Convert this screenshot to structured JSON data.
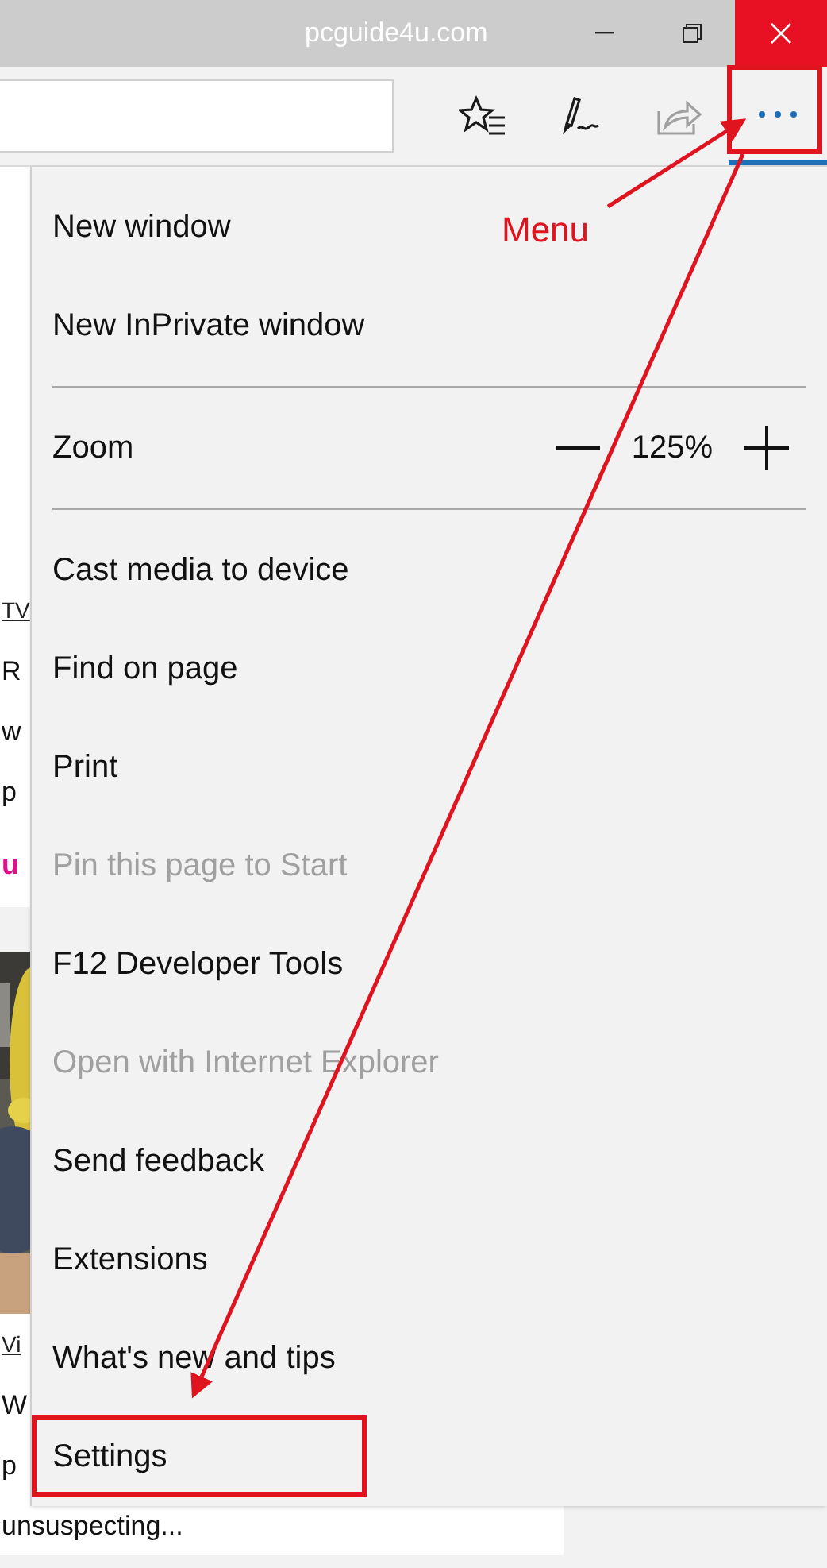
{
  "window": {
    "title": "pcguide4u.com"
  },
  "toolbar": {
    "buttons": [
      {
        "kind": "favorites",
        "disabled": false
      },
      {
        "kind": "notes",
        "disabled": false
      },
      {
        "kind": "share",
        "disabled": true
      },
      {
        "kind": "more",
        "disabled": false
      }
    ]
  },
  "page": {
    "fragments": [
      {
        "kind": "tag",
        "text": "TV"
      },
      {
        "kind": "headline",
        "text": "R"
      },
      {
        "kind": "headline",
        "text": "w"
      },
      {
        "kind": "headline",
        "text": "p"
      },
      {
        "kind": "brand",
        "text": "u"
      },
      {
        "kind": "picture"
      },
      {
        "kind": "tag",
        "text": "Vi"
      },
      {
        "kind": "headline",
        "text": "W"
      },
      {
        "kind": "headline",
        "text": "p"
      },
      {
        "kind": "headline",
        "text": "unsuspecting..."
      }
    ]
  },
  "menu": {
    "items": [
      {
        "kind": "item",
        "label": "New window",
        "disabled": false
      },
      {
        "kind": "item",
        "label": "New InPrivate window",
        "disabled": false
      },
      {
        "kind": "divider"
      },
      {
        "kind": "zoom",
        "label": "Zoom",
        "value": "125%"
      },
      {
        "kind": "divider"
      },
      {
        "kind": "item",
        "label": "Cast media to device",
        "disabled": false
      },
      {
        "kind": "item",
        "label": "Find on page",
        "disabled": false
      },
      {
        "kind": "item",
        "label": "Print",
        "disabled": false
      },
      {
        "kind": "item",
        "label": "Pin this page to Start",
        "disabled": true
      },
      {
        "kind": "item",
        "label": "F12 Developer Tools",
        "disabled": false
      },
      {
        "kind": "item",
        "label": "Open with Internet Explorer",
        "disabled": true
      },
      {
        "kind": "item",
        "label": "Send feedback",
        "disabled": false
      },
      {
        "kind": "item",
        "label": "Extensions",
        "disabled": false
      },
      {
        "kind": "item",
        "label": "What's new and tips",
        "disabled": false
      },
      {
        "kind": "item",
        "label": "Settings",
        "disabled": false
      }
    ]
  },
  "annotations": {
    "label": "Menu"
  }
}
